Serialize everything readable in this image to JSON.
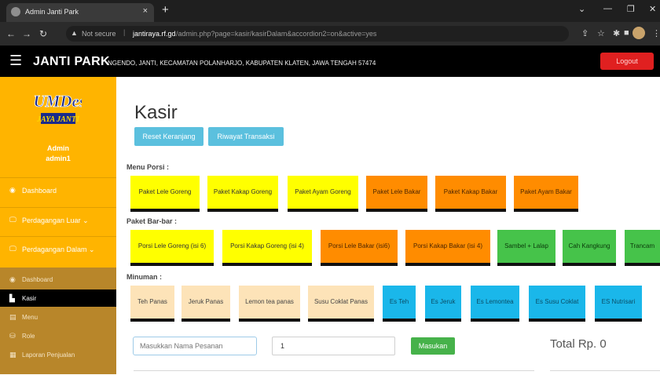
{
  "browser": {
    "tab_title": "Admin Janti Park",
    "tab_close": "×",
    "new_tab": "+",
    "secure_label": "Not secure",
    "url_domain": "jantiraya.rf.gd",
    "url_path": "/admin.php?page=kasir/kasirDalam&accordion2=on&active=yes"
  },
  "header": {
    "brand": "JANTI PARK",
    "address": "NGENDO, JANTI, KECAMATAN POLANHARJO, KABUPATEN KLATEN, JAWA TENGAH 57474",
    "logout": "Logout"
  },
  "sidebar": {
    "logo_line1": "BUMDesa",
    "logo_line2": "JAYA JANTI",
    "role": "Admin",
    "username": "admin1",
    "items": [
      {
        "label": "Dashboard",
        "icon": "dashboard-icon"
      },
      {
        "label": "Perdagangan Luar ⌄",
        "icon": "monitor-icon"
      },
      {
        "label": "Perdagangan Dalam ⌄",
        "icon": "monitor-icon"
      }
    ],
    "sub_items": [
      {
        "label": "Dashboard",
        "icon": "dashboard-icon"
      },
      {
        "label": "Kasir",
        "icon": "cashier-icon"
      },
      {
        "label": "Menu",
        "icon": "menu-icon"
      },
      {
        "label": "Role",
        "icon": "role-icon"
      },
      {
        "label": "Laporan Penjualan",
        "icon": "report-icon"
      }
    ]
  },
  "main": {
    "title": "Kasir",
    "reset_button": "Reset Keranjang",
    "history_button": "Riwayat Transaksi",
    "sections": [
      {
        "label": "Menu Porsi :",
        "items": [
          {
            "label": "Paket Lele Goreng",
            "color": "#ffff00"
          },
          {
            "label": "Paket Kakap Goreng",
            "color": "#ffff00"
          },
          {
            "label": "Paket Ayam Goreng",
            "color": "#ffff00"
          },
          {
            "label": "Paket Lele Bakar",
            "color": "#ff8c00"
          },
          {
            "label": "Paket Kakap Bakar",
            "color": "#ff8c00"
          },
          {
            "label": "Paket Ayam Bakar",
            "color": "#ff8c00"
          }
        ]
      },
      {
        "label": "Paket Bar-bar :",
        "items": [
          {
            "label": "Porsi Lele Goreng (isi 6)",
            "color": "#ffff00"
          },
          {
            "label": "Porsi Kakap Goreng (isi 4)",
            "color": "#ffff00"
          },
          {
            "label": "Porsi Lele Bakar (isi6)",
            "color": "#ff8c00"
          },
          {
            "label": "Porsi Kakap Bakar (isi 4)",
            "color": "#ff8c00"
          },
          {
            "label": "Sambel + Lalap",
            "color": "#46c34a"
          },
          {
            "label": "Cah Kangkung",
            "color": "#46c34a"
          },
          {
            "label": "Trancam",
            "color": "#46c34a"
          }
        ]
      },
      {
        "label": "Minuman :",
        "items": [
          {
            "label": "Teh Panas",
            "color": "#fde3b8"
          },
          {
            "label": "Jeruk Panas",
            "color": "#fde3b8"
          },
          {
            "label": "Lemon tea panas",
            "color": "#fde3b8"
          },
          {
            "label": "Susu Coklat Panas",
            "color": "#fde3b8"
          },
          {
            "label": "Es Teh",
            "color": "#1ab7ea"
          },
          {
            "label": "Es Jeruk",
            "color": "#1ab7ea"
          },
          {
            "label": "Es Lemontea",
            "color": "#1ab7ea"
          },
          {
            "label": "Es Susu Coklat",
            "color": "#1ab7ea"
          },
          {
            "label": "ES Nutrisari",
            "color": "#1ab7ea"
          }
        ]
      }
    ],
    "order_name_placeholder": "Masukkan Nama Pesanan",
    "quantity_value": "1",
    "submit_button": "Masukan",
    "total": "Total Rp. 0"
  }
}
